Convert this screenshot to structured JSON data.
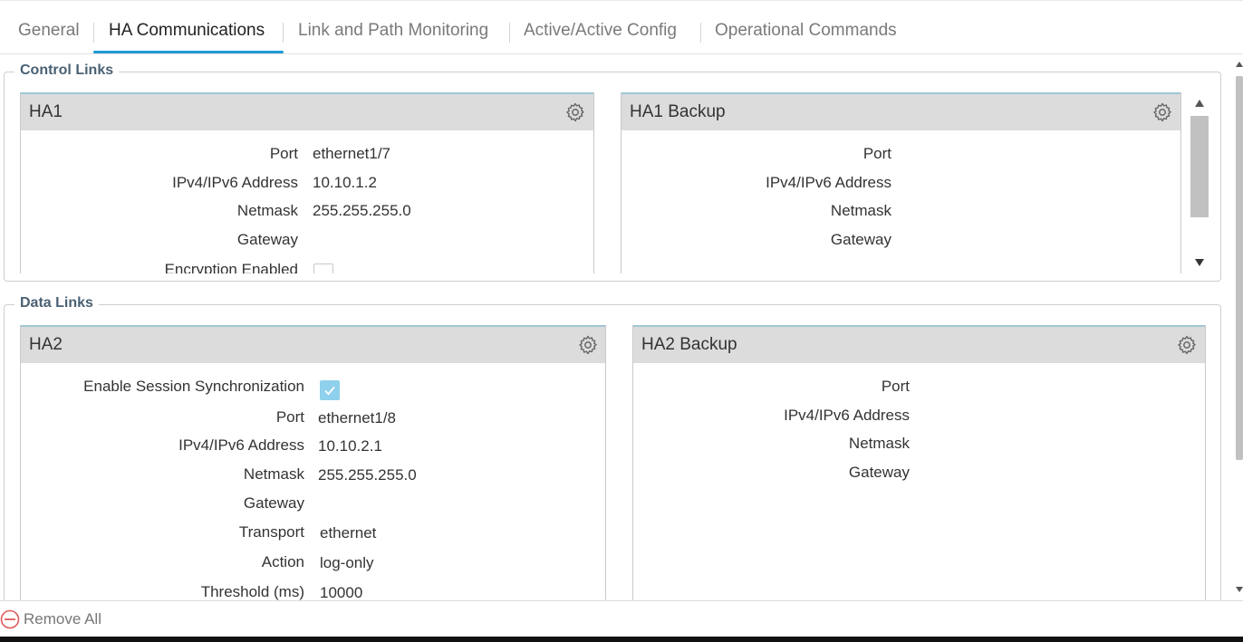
{
  "tabs": [
    {
      "label": "General",
      "active": false
    },
    {
      "label": "HA Communications",
      "active": true
    },
    {
      "label": "Link and Path Monitoring",
      "active": false
    },
    {
      "label": "Active/Active Config",
      "active": false
    },
    {
      "label": "Operational Commands",
      "active": false
    }
  ],
  "control_links": {
    "legend": "Control Links",
    "ha1": {
      "title": "HA1",
      "rows": [
        {
          "label": "Port",
          "value": "ethernet1/7"
        },
        {
          "label": "IPv4/IPv6 Address",
          "value": "10.10.1.2"
        },
        {
          "label": "Netmask",
          "value": "255.255.255.0"
        },
        {
          "label": "Gateway",
          "value": ""
        }
      ],
      "encryption_label": "Encryption Enabled",
      "encryption_checked": false
    },
    "ha1_backup": {
      "title": "HA1 Backup",
      "rows": [
        {
          "label": "Port",
          "value": ""
        },
        {
          "label": "IPv4/IPv6 Address",
          "value": ""
        },
        {
          "label": "Netmask",
          "value": ""
        },
        {
          "label": "Gateway",
          "value": ""
        }
      ]
    }
  },
  "data_links": {
    "legend": "Data Links",
    "ha2": {
      "title": "HA2",
      "session_sync_label": "Enable Session Synchronization",
      "session_sync_checked": true,
      "rows": [
        {
          "label": "Port",
          "value": "ethernet1/8"
        },
        {
          "label": "IPv4/IPv6 Address",
          "value": "10.10.2.1"
        },
        {
          "label": "Netmask",
          "value": "255.255.255.0"
        },
        {
          "label": "Gateway",
          "value": ""
        },
        {
          "label": "Transport",
          "value": "ethernet"
        },
        {
          "label": "Action",
          "value": "log-only"
        },
        {
          "label": "Threshold (ms)",
          "value": "10000"
        }
      ]
    },
    "ha2_backup": {
      "title": "HA2 Backup",
      "rows": [
        {
          "label": "Port",
          "value": ""
        },
        {
          "label": "IPv4/IPv6 Address",
          "value": ""
        },
        {
          "label": "Netmask",
          "value": ""
        },
        {
          "label": "Gateway",
          "value": ""
        }
      ]
    }
  },
  "footer": {
    "remove_all_label": "Remove All"
  },
  "icons": {
    "gear": "gear-icon",
    "remove": "remove-circle-icon",
    "check": "checkmark-icon"
  },
  "colors": {
    "accent": "#1e9ad6",
    "panel_header": "#dcdcdc",
    "checkbox_checked": "#8fd0ec",
    "remove_icon": "#e05a5a"
  }
}
